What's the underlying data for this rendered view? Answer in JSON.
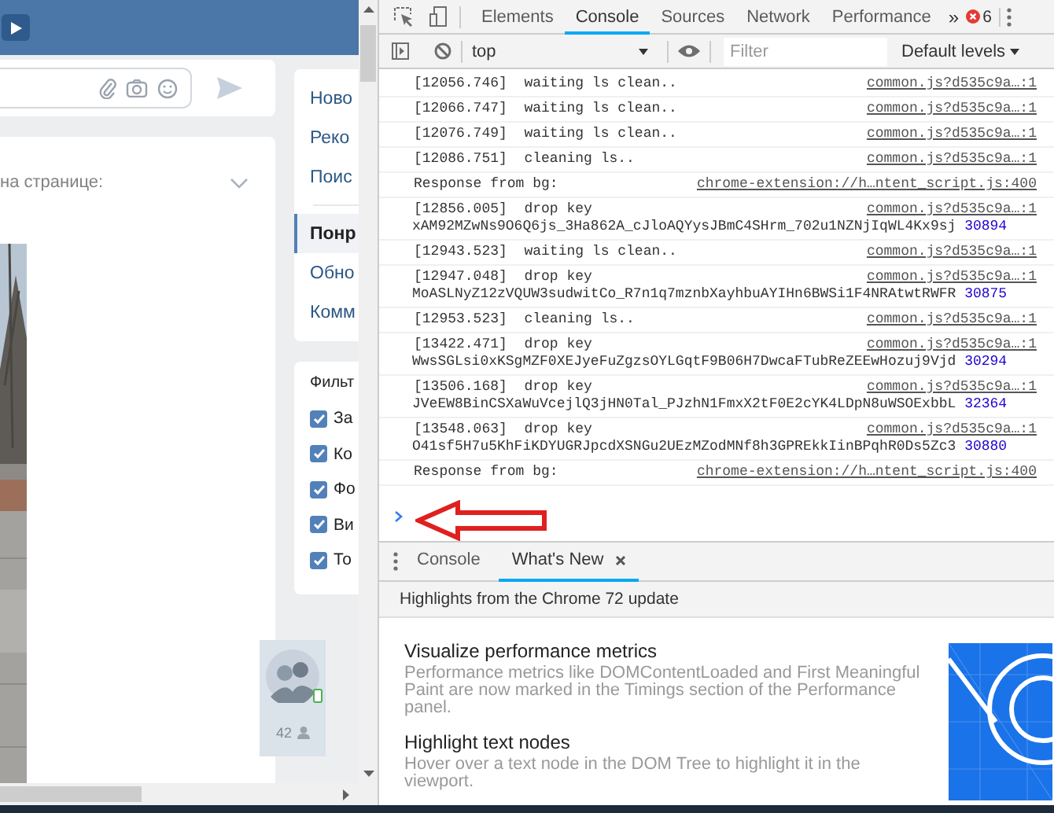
{
  "page": {
    "feed_header": "на странице:",
    "menu_groups": [
      [
        {
          "label": "Ново",
          "selected": false
        },
        {
          "label": "Реко",
          "selected": false
        },
        {
          "label": "Поис",
          "selected": false
        }
      ],
      [
        {
          "label": "Понр",
          "selected": true
        },
        {
          "label": "Обно",
          "selected": false
        },
        {
          "label": "Комм",
          "selected": false
        }
      ]
    ],
    "filter": {
      "title": "Фильт",
      "options": [
        {
          "label": "За",
          "checked": true
        },
        {
          "label": "Ко",
          "checked": true
        },
        {
          "label": "Фо",
          "checked": true
        },
        {
          "label": "Ви",
          "checked": true
        },
        {
          "label": "То",
          "checked": true
        }
      ]
    },
    "online_count": "42"
  },
  "devtools": {
    "tabs": [
      {
        "label": "Elements",
        "selected": false
      },
      {
        "label": "Console",
        "selected": true
      },
      {
        "label": "Sources",
        "selected": false
      },
      {
        "label": "Network",
        "selected": false
      },
      {
        "label": "Performance",
        "selected": false
      }
    ],
    "more": "»",
    "error_count": "6",
    "context": "top",
    "filter_placeholder": "Filter",
    "levels": "Default levels",
    "log": [
      {
        "message": "[12056.746]  waiting ls clean..",
        "source": "common.js?d535c9a…:1"
      },
      {
        "message": "[12066.747]  waiting ls clean..",
        "source": "common.js?d535c9a…:1"
      },
      {
        "message": "[12076.749]  waiting ls clean..",
        "source": "common.js?d535c9a…:1"
      },
      {
        "message": "[12086.751]  cleaning ls..",
        "source": "common.js?d535c9a…:1"
      },
      {
        "message": "Response from bg:",
        "source": "chrome-extension://h…ntent_script.js:400"
      },
      {
        "message": "[12856.005]  drop key",
        "source": "common.js?d535c9a…:1",
        "key": "xAM92MZwNs9O6Q6js_3Ha862A_cJloAQYysJBmC4SHrm_702u1NZNjIqWL4Kx9sj",
        "number": "30894"
      },
      {
        "message": "[12943.523]  waiting ls clean..",
        "source": "common.js?d535c9a…:1"
      },
      {
        "message": "[12947.048]  drop key",
        "source": "common.js?d535c9a…:1",
        "key": "MoASLNyZ12zVQUW3sudwitCo_R7n1q7mznbXayhbuAYIHn6BWSi1F4NRAtwtRWFR",
        "number": "30875"
      },
      {
        "message": "[12953.523]  cleaning ls..",
        "source": "common.js?d535c9a…:1"
      },
      {
        "message": "[13422.471]  drop key",
        "source": "common.js?d535c9a…:1",
        "key": "WwsSGLsi0xKSgMZF0XEJyeFuZgzsOYLGqtF9B06H7DwcaFTubReZEEwHozuj9Vjd",
        "number": "30294"
      },
      {
        "message": "[13506.168]  drop key",
        "source": "common.js?d535c9a…:1",
        "key": "JVeEW8BinCSXaWuVcejlQ3jHN0Tal_PJzhN1FmxX2tF0E2cYK4LDpN8uWSOExbbL",
        "number": "32364"
      },
      {
        "message": "[13548.063]  drop key",
        "source": "common.js?d535c9a…:1",
        "key": "O41sf5H7u5KhFiKDYUGRJpcdXSNGu2UEzMZodMNf8h3GPREkkIinBPqhR0Ds5Zc3",
        "number": "30880"
      },
      {
        "message": "Response from bg:",
        "source": "chrome-extension://h…ntent_script.js:400"
      }
    ],
    "drawer": {
      "tabs": [
        {
          "label": "Console",
          "selected": false,
          "closable": false
        },
        {
          "label": "What's New",
          "selected": true,
          "closable": true
        }
      ],
      "banner": "Highlights from the Chrome 72 update",
      "items": [
        {
          "title": "Visualize performance metrics",
          "body": "Performance metrics like DOMContentLoaded and First Meaningful Paint are now marked in the Timings section of the Performance panel."
        },
        {
          "title": "Highlight text nodes",
          "body": "Hover over a text node in the DOM Tree to highlight it in the viewport."
        }
      ]
    }
  }
}
